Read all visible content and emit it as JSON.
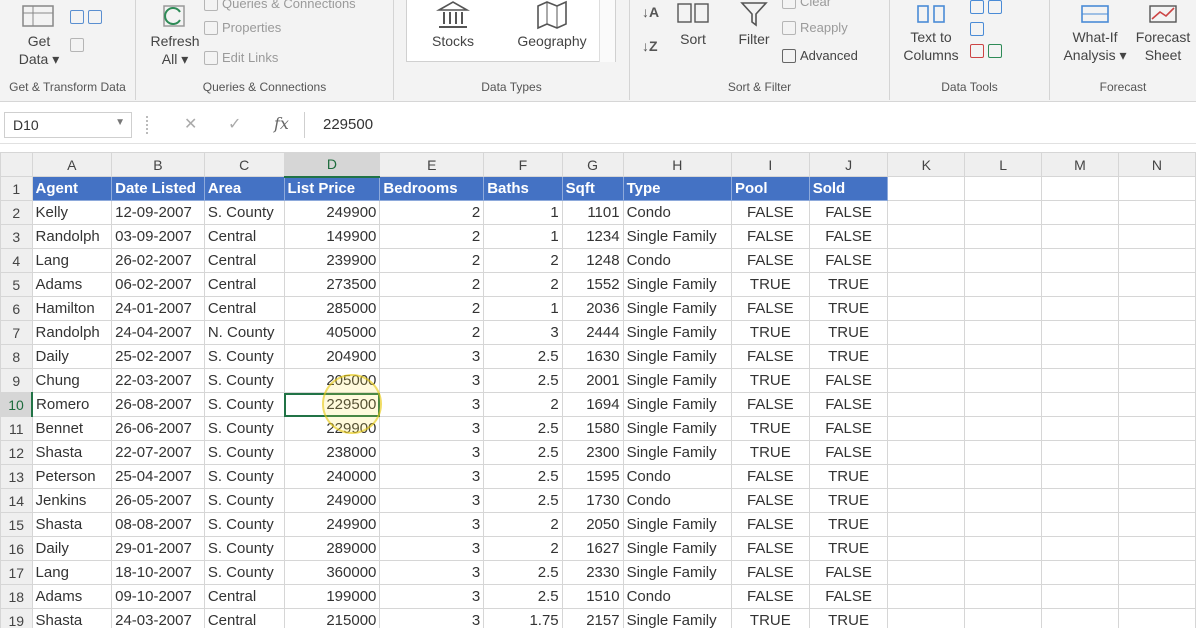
{
  "ribbon": {
    "groups": {
      "get_transform": "Get & Transform Data",
      "queries": "Queries & Connections",
      "data_types": "Data Types",
      "sort_filter": "Sort & Filter",
      "data_tools": "Data Tools",
      "forecast": "Forecast"
    },
    "get_data": "Get\nData",
    "get_data_l1": "Get",
    "get_data_l2": "Data ▾",
    "refresh_l1": "Refresh",
    "refresh_l2": "All ▾",
    "queries_connections": "Queries & Connections",
    "properties": "Properties",
    "edit_links": "Edit Links",
    "stocks": "Stocks",
    "geography": "Geography",
    "sort": "Sort",
    "filter": "Filter",
    "clear": "Clear",
    "reapply": "Reapply",
    "advanced": "Advanced",
    "text_to_columns_l1": "Text to",
    "text_to_columns_l2": "Columns",
    "what_if_l1": "What-If",
    "what_if_l2": "Analysis ▾",
    "forecast_sheet_l1": "Forecast",
    "forecast_sheet_l2": "Sheet"
  },
  "formula_bar": {
    "name_box": "D10",
    "value": "229500"
  },
  "columns": [
    "A",
    "B",
    "C",
    "D",
    "E",
    "F",
    "G",
    "H",
    "I",
    "J",
    "K",
    "L",
    "M",
    "N"
  ],
  "header_row": [
    "Agent",
    "Date Listed",
    "Area",
    "List Price",
    "Bedrooms",
    "Baths",
    "Sqft",
    "Type",
    "Pool",
    "Sold"
  ],
  "rows": [
    [
      "Kelly",
      "12-09-2007",
      "S. County",
      "249900",
      "2",
      "1",
      "1101",
      "Condo",
      "FALSE",
      "FALSE"
    ],
    [
      "Randolph",
      "03-09-2007",
      "Central",
      "149900",
      "2",
      "1",
      "1234",
      "Single Family",
      "FALSE",
      "FALSE"
    ],
    [
      "Lang",
      "26-02-2007",
      "Central",
      "239900",
      "2",
      "2",
      "1248",
      "Condo",
      "FALSE",
      "FALSE"
    ],
    [
      "Adams",
      "06-02-2007",
      "Central",
      "273500",
      "2",
      "2",
      "1552",
      "Single Family",
      "TRUE",
      "TRUE"
    ],
    [
      "Hamilton",
      "24-01-2007",
      "Central",
      "285000",
      "2",
      "1",
      "2036",
      "Single Family",
      "FALSE",
      "TRUE"
    ],
    [
      "Randolph",
      "24-04-2007",
      "N. County",
      "405000",
      "2",
      "3",
      "2444",
      "Single Family",
      "TRUE",
      "TRUE"
    ],
    [
      "Daily",
      "25-02-2007",
      "S. County",
      "204900",
      "3",
      "2.5",
      "1630",
      "Single Family",
      "FALSE",
      "TRUE"
    ],
    [
      "Chung",
      "22-03-2007",
      "S. County",
      "205000",
      "3",
      "2.5",
      "2001",
      "Single Family",
      "TRUE",
      "FALSE"
    ],
    [
      "Romero",
      "26-08-2007",
      "S. County",
      "229500",
      "3",
      "2",
      "1694",
      "Single Family",
      "FALSE",
      "FALSE"
    ],
    [
      "Bennet",
      "26-06-2007",
      "S. County",
      "229900",
      "3",
      "2.5",
      "1580",
      "Single Family",
      "TRUE",
      "FALSE"
    ],
    [
      "Shasta",
      "22-07-2007",
      "S. County",
      "238000",
      "3",
      "2.5",
      "2300",
      "Single Family",
      "TRUE",
      "FALSE"
    ],
    [
      "Peterson",
      "25-04-2007",
      "S. County",
      "240000",
      "3",
      "2.5",
      "1595",
      "Condo",
      "FALSE",
      "TRUE"
    ],
    [
      "Jenkins",
      "26-05-2007",
      "S. County",
      "249000",
      "3",
      "2.5",
      "1730",
      "Condo",
      "FALSE",
      "TRUE"
    ],
    [
      "Shasta",
      "08-08-2007",
      "S. County",
      "249900",
      "3",
      "2",
      "2050",
      "Single Family",
      "FALSE",
      "TRUE"
    ],
    [
      "Daily",
      "29-01-2007",
      "S. County",
      "289000",
      "3",
      "2",
      "1627",
      "Single Family",
      "FALSE",
      "TRUE"
    ],
    [
      "Lang",
      "18-10-2007",
      "S. County",
      "360000",
      "3",
      "2.5",
      "2330",
      "Single Family",
      "FALSE",
      "FALSE"
    ],
    [
      "Adams",
      "09-10-2007",
      "Central",
      "199000",
      "3",
      "2.5",
      "1510",
      "Condo",
      "FALSE",
      "FALSE"
    ],
    [
      "Shasta",
      "24-03-2007",
      "Central",
      "215000",
      "3",
      "1.75",
      "2157",
      "Single Family",
      "TRUE",
      "TRUE"
    ]
  ],
  "colors": {
    "header_fill": "#4472c4",
    "header_text": "#ffffff",
    "selection": "#217346"
  }
}
